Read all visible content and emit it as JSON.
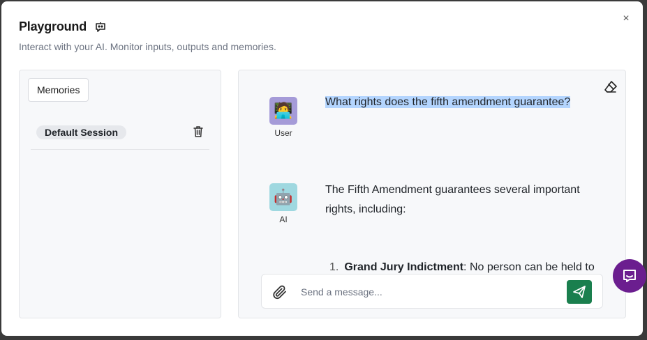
{
  "dialog": {
    "title": "Playground",
    "subtitle": "Interact with your AI. Monitor inputs, outputs and memories.",
    "close_glyph": "×"
  },
  "sidebar": {
    "memories_label": "Memories",
    "sessions": [
      {
        "label": "Default Session"
      }
    ]
  },
  "chat": {
    "messages": [
      {
        "role": "User",
        "avatar": "🧑‍💻",
        "text": "What rights does the fifth amendment guarantee?"
      },
      {
        "role": "AI",
        "avatar": "🤖",
        "text_line1": "The Fifth Amendment guarantees several important",
        "text_line2": "rights, including:"
      }
    ],
    "list_items": [
      {
        "number": "1.",
        "bold": "Grand Jury Indictment",
        "rest": ": No person can be held to"
      }
    ],
    "input_placeholder": "Send a message..."
  },
  "colors": {
    "send_button": "#1a7f4e",
    "intercom": "#6b1e8f",
    "user_avatar_bg": "#a59bd8",
    "ai_avatar_bg": "#9fd8e0",
    "selection": "#b4d5fe"
  },
  "icons": {
    "title": "bot-message-icon",
    "trash": "trash-icon",
    "eraser": "eraser-icon",
    "attach": "paperclip-icon",
    "send": "send-icon",
    "chat_launcher": "chat-bubble-icon"
  }
}
